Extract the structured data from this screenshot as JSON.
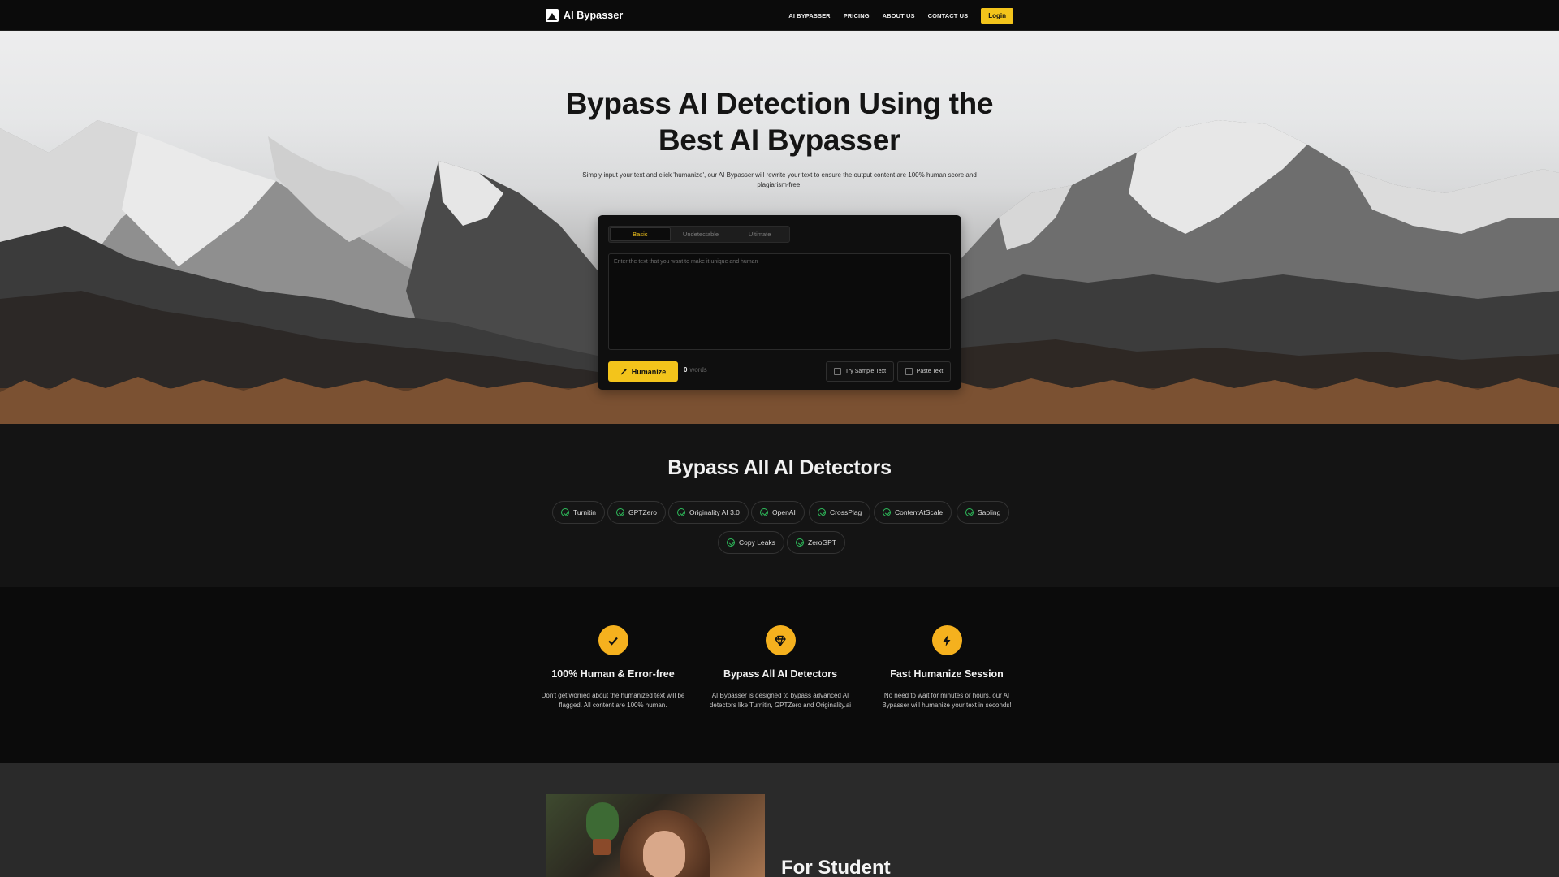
{
  "nav": {
    "brand": "AI Bypasser",
    "links": [
      "AI BYPASSER",
      "PRICING",
      "ABOUT US",
      "CONTACT US"
    ],
    "login": "Login"
  },
  "hero": {
    "title_line1": "Bypass AI Detection Using the",
    "title_line2": "Best AI Bypasser",
    "subtitle": "Simply input your text and click 'humanize', our AI Bypasser will rewrite your text to ensure the output content are 100% human score and plagiarism-free."
  },
  "editor": {
    "tabs": [
      {
        "label": "Basic",
        "active": true
      },
      {
        "label": "Undetectable",
        "active": false
      },
      {
        "label": "Ultimate",
        "active": false
      }
    ],
    "placeholder": "Enter the text that you want to make it unique and human",
    "value": "",
    "humanize_label": "Humanize",
    "word_count": "0",
    "word_unit": "words",
    "sample_label": "Try Sample Text",
    "paste_label": "Paste Text"
  },
  "detectors": {
    "title": "Bypass All AI Detectors",
    "row1": [
      "Turnitin",
      "GPTZero",
      "Originality AI 3.0",
      "OpenAI",
      "CrossPlag",
      "ContentAtScale",
      "Sapling"
    ],
    "row2": [
      "Copy Leaks",
      "ZeroGPT"
    ]
  },
  "features": [
    {
      "icon": "check-icon",
      "title": "100% Human & Error-free",
      "desc": "Don't get worried about the humanized text will be flagged. All content are 100% human."
    },
    {
      "icon": "diamond-icon",
      "title": "Bypass All AI Detectors",
      "desc": "AI Bypasser is designed to bypass advanced AI detectors like Turnitin, GPTZero and Originality.ai"
    },
    {
      "icon": "lightning-icon",
      "title": "Fast Humanize Session",
      "desc": "No need to wait for minutes or hours, our AI Bypasser will humanize your text in seconds!"
    }
  ],
  "student": {
    "title": "For Student"
  },
  "colors": {
    "accent": "#f3c41b",
    "feature_icon": "#f5b11e",
    "check": "#2ebc5b"
  }
}
